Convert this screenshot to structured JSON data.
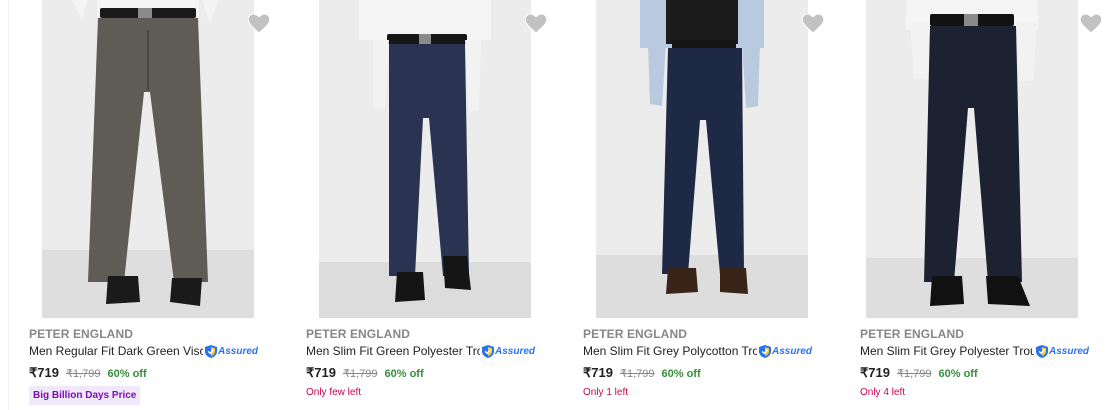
{
  "colors": {
    "brand_text": "#878787",
    "title_text": "#212121",
    "discount_green": "#388e3c",
    "stock_red": "#c7064f",
    "assured_blue": "#2874f0",
    "offer_purple": "#7a0fb6",
    "heart_grey": "#c2c2c2"
  },
  "products": [
    {
      "brand": "PETER ENGLAND",
      "title": "Men Regular Fit Dark Green Visc...",
      "assured_label": "Assured",
      "price": "₹719",
      "mrp": "₹1,799",
      "discount": "60% off",
      "badge": "Big Billion Days Price",
      "stock": "",
      "trouser_color": "#5f5c55",
      "shoe_color": "#1a1a1a",
      "image_alt": "Grey-green regular fit trousers",
      "wishlist_icon": "heart-icon"
    },
    {
      "brand": "PETER ENGLAND",
      "title": "Men Slim Fit Green Polyester Tro...",
      "assured_label": "Assured",
      "price": "₹719",
      "mrp": "₹1,799",
      "discount": "60% off",
      "badge": "",
      "stock": "Only few left",
      "trouser_color": "#2b3352",
      "shoe_color": "#151515",
      "image_alt": "Navy slim fit trousers",
      "wishlist_icon": "heart-icon"
    },
    {
      "brand": "PETER ENGLAND",
      "title": "Men Slim Fit Grey Polycotton Tro...",
      "assured_label": "Assured",
      "price": "₹719",
      "mrp": "₹1,799",
      "discount": "60% off",
      "badge": "",
      "stock": "Only 1 left",
      "trouser_color": "#1e2a45",
      "shoe_color": "#3a2418",
      "image_alt": "Dark navy slim fit trousers",
      "wishlist_icon": "heart-icon"
    },
    {
      "brand": "PETER ENGLAND",
      "title": "Men Slim Fit Grey Polyester Trou...",
      "assured_label": "Assured",
      "price": "₹719",
      "mrp": "₹1,799",
      "discount": "60% off",
      "badge": "",
      "stock": "Only 4 left",
      "trouser_color": "#1d2233",
      "shoe_color": "#111111",
      "image_alt": "Charcoal slim fit trousers",
      "wishlist_icon": "heart-icon"
    }
  ]
}
